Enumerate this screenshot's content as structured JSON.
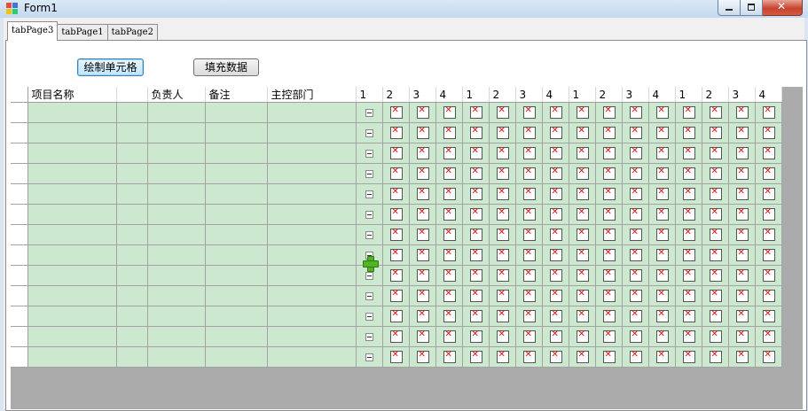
{
  "window": {
    "title": "Form1"
  },
  "tabs": [
    {
      "label": "tabPage3",
      "active": true
    },
    {
      "label": "tabPage1",
      "active": false
    },
    {
      "label": "tabPage2",
      "active": false
    }
  ],
  "toolbar": {
    "draw_cell_label": "绘制单元格",
    "fill_data_label": "填充数据"
  },
  "grid": {
    "columns": [
      "项目名称",
      "",
      "负责人",
      "备注",
      "主控部门",
      "1",
      "2",
      "3",
      "4",
      "1",
      "2",
      "3",
      "4",
      "1",
      "2",
      "3",
      "4",
      "1",
      "2",
      "3",
      "4"
    ],
    "row_count": 13,
    "colors": {
      "cell_bg": "#cce8cf",
      "x_mark": "#e01010",
      "plus_icon": "#53b324"
    }
  }
}
